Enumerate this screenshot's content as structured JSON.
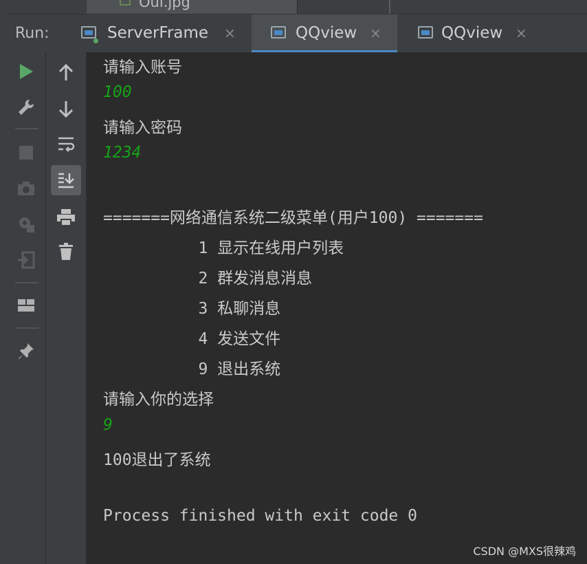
{
  "editor_tab": {
    "filename": "Oul.jpg"
  },
  "run_panel": {
    "label": "Run:",
    "tabs": [
      {
        "label": "ServerFrame",
        "close": "×"
      },
      {
        "label": "QQview",
        "close": "×",
        "active": true
      },
      {
        "label": "QQview",
        "close": "×"
      }
    ]
  },
  "toolbar_left": [
    "run-icon",
    "wrench-icon",
    "stop-icon",
    "camera-icon",
    "settings-bug-icon",
    "login-icon",
    "layout-icon",
    "pin-icon"
  ],
  "toolbar_right": [
    "arrow-up-icon",
    "arrow-down-icon",
    "soft-wrap-icon",
    "scroll-to-end-icon",
    "print-icon",
    "trash-icon"
  ],
  "console": {
    "lines": [
      {
        "text": "请输入账号",
        "type": "output"
      },
      {
        "text": "100",
        "type": "input"
      },
      {
        "text": "请输入密码",
        "type": "output"
      },
      {
        "text": "1234",
        "type": "input"
      },
      {
        "text": "",
        "type": "output"
      },
      {
        "text": "=======网络通信系统二级菜单(用户100) =======",
        "type": "output"
      },
      {
        "text": "          1 显示在线用户列表",
        "type": "output"
      },
      {
        "text": "          2 群发消息消息",
        "type": "output"
      },
      {
        "text": "          3 私聊消息",
        "type": "output"
      },
      {
        "text": "          4 发送文件",
        "type": "output"
      },
      {
        "text": "          9 退出系统",
        "type": "output"
      },
      {
        "text": "请输入你的选择",
        "type": "output"
      },
      {
        "text": "9",
        "type": "input"
      },
      {
        "text": "100退出了系统",
        "type": "output"
      },
      {
        "text": "",
        "type": "output"
      },
      {
        "text": "Process finished with exit code 0",
        "type": "output"
      }
    ]
  },
  "watermark": "CSDN @MXS很辣鸡",
  "colors": {
    "accent": "#4a88c7",
    "input_text": "#16a316",
    "run_green": "#59a869"
  }
}
